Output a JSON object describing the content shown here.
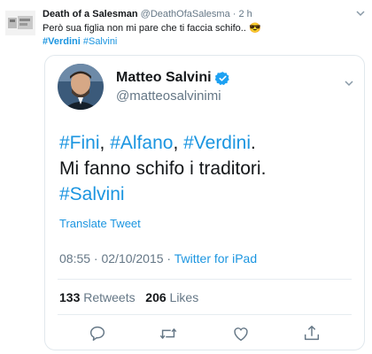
{
  "outer_tweet": {
    "author_name": "Death of a Salesman",
    "author_handle": "@DeathOfaSalesma",
    "separator": "·",
    "time": "2 h",
    "text": "Però sua figlia non mi pare che ti faccia schifo..",
    "emoji": "😎",
    "hashtag_1": "#Verdini",
    "hashtag_2": "#Salvini",
    "chevron_icon": "chevron-down-icon"
  },
  "quoted_tweet": {
    "name": "Matteo Salvini",
    "handle": "@matteosalvinimi",
    "verified_icon": "verified-badge-icon",
    "text": {
      "link_fini": "#Fini",
      "comma_1": ", ",
      "link_alfano": "#Alfano",
      "comma_2": ", ",
      "link_verdini": "#Verdini",
      "period": ".",
      "line_2": "Mi fanno schifo i traditori.",
      "link_salvini": "#Salvini"
    },
    "translate_label": "Translate Tweet",
    "timestamp": "08:55 · 02/10/2015 ·",
    "source": "Twitter for iPad",
    "retweets_count": "133",
    "retweets_label": "Retweets",
    "likes_count": "206",
    "likes_label": "Likes",
    "actions": [
      {
        "name": "reply-icon"
      },
      {
        "name": "retweet-icon"
      },
      {
        "name": "like-icon"
      },
      {
        "name": "share-icon"
      }
    ]
  },
  "colors": {
    "link_blue": "#1b95e0",
    "verified_blue": "#1da1f2",
    "gray_text": "#657786",
    "border": "#e1e8ed"
  }
}
